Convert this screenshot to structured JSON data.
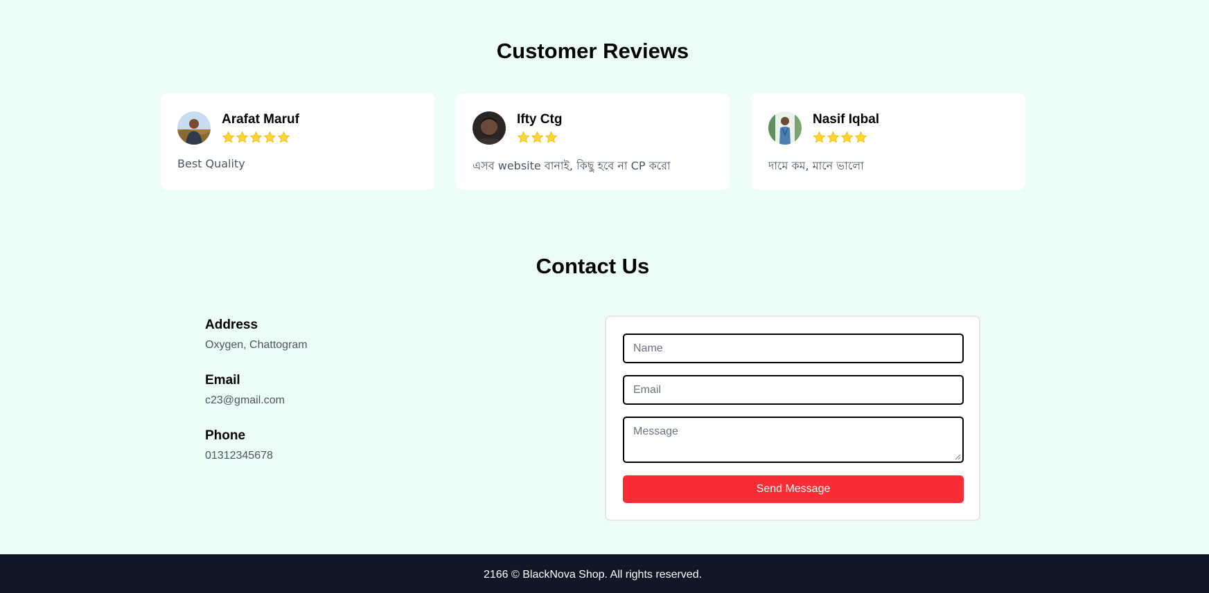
{
  "reviews": {
    "title": "Customer Reviews",
    "items": [
      {
        "name": "Arafat Maruf",
        "rating": 5,
        "text": "Best Quality"
      },
      {
        "name": "Ifty Ctg",
        "rating": 3,
        "text": "এসব website বানাই, কিছু হবে না CP করো"
      },
      {
        "name": "Nasif Iqbal",
        "rating": 4,
        "text": "দামে কম, মানে ভালো"
      }
    ]
  },
  "contact": {
    "title": "Contact Us",
    "address_label": "Address",
    "address_value": "Oxygen, Chattogram",
    "email_label": "Email",
    "email_value": "c23@gmail.com",
    "phone_label": "Phone",
    "phone_value": "01312345678",
    "form": {
      "name_placeholder": "Name",
      "email_placeholder": "Email",
      "message_placeholder": "Message",
      "send_label": "Send Message"
    }
  },
  "footer": {
    "text": "2166 © BlackNova Shop. All rights reserved."
  },
  "colors": {
    "background": "#ecfdf5",
    "star": "#fdd835",
    "send_button": "#fb2c36",
    "footer": "#101828"
  }
}
